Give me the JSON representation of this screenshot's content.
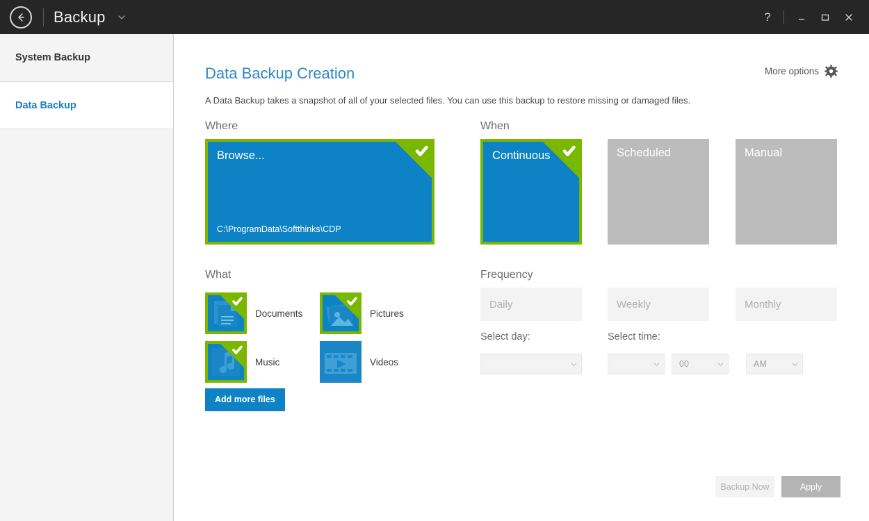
{
  "titlebar": {
    "back_icon": "back-arrow-icon",
    "title": "Backup",
    "chevron_icon": "chevron-down-icon",
    "help_label": "?",
    "minimize_label": "—",
    "maximize_label": "☐",
    "close_label": "✕"
  },
  "sidebar": {
    "items": [
      {
        "label": "System Backup",
        "selected": false
      },
      {
        "label": "Data Backup",
        "selected": true
      }
    ]
  },
  "main": {
    "page_title": "Data Backup Creation",
    "more_options_label": "More options",
    "more_options_icon": "gear-icon",
    "description": "A Data Backup takes a snapshot of all of your selected files. You can use this backup to restore missing or damaged files.",
    "where": {
      "label": "Where",
      "tile": {
        "title": "Browse...",
        "path": "C:\\ProgramData\\Softthinks\\CDP",
        "selected": true
      }
    },
    "when": {
      "label": "When",
      "options": [
        {
          "label": "Continuous",
          "selected": true
        },
        {
          "label": "Scheduled",
          "selected": false
        },
        {
          "label": "Manual",
          "selected": false
        }
      ]
    },
    "what": {
      "label": "What",
      "items": [
        {
          "label": "Documents",
          "icon": "documents-icon",
          "checked": true
        },
        {
          "label": "Pictures",
          "icon": "pictures-icon",
          "checked": true
        },
        {
          "label": "Music",
          "icon": "music-icon",
          "checked": true
        },
        {
          "label": "Videos",
          "icon": "videos-icon",
          "checked": false
        }
      ],
      "add_more_label": "Add more files"
    },
    "frequency": {
      "label": "Frequency",
      "options": [
        {
          "label": "Daily",
          "selected": false
        },
        {
          "label": "Weekly",
          "selected": false
        },
        {
          "label": "Monthly",
          "selected": false
        }
      ],
      "select_day_label": "Select day:",
      "select_time_label": "Select time:",
      "day_value": "",
      "hour_value": "",
      "minute_value": "00",
      "ampm_value": "AM"
    },
    "footer": {
      "backup_now_label": "Backup Now",
      "apply_label": "Apply"
    }
  },
  "colors": {
    "titlebar_bg": "#262626",
    "accent_blue": "#0d83c5",
    "link_blue": "#1a7fc1",
    "heading_blue": "#2e87c6",
    "select_green": "#7ab800",
    "disabled_gray": "#bcbcbc",
    "field_gray": "#f3f3f3"
  }
}
